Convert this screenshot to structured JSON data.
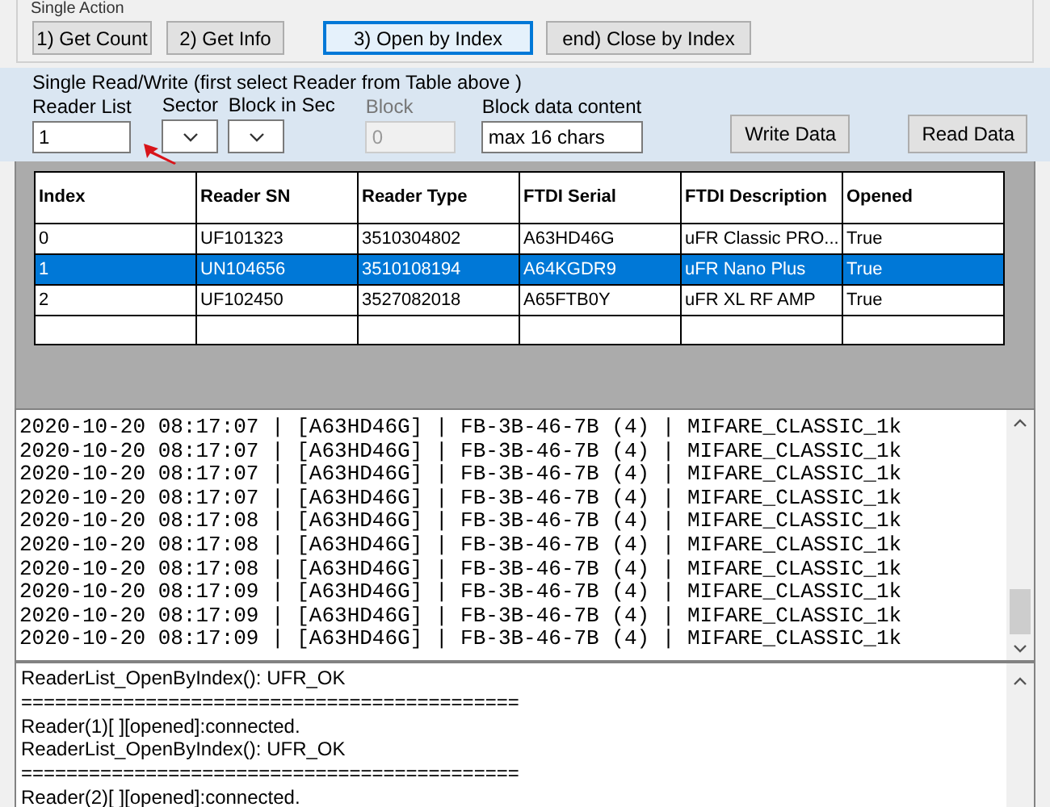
{
  "single_action": {
    "title": "Single Action",
    "buttons": [
      {
        "label": "1) Get Count",
        "selected": false
      },
      {
        "label": "2) Get Info",
        "selected": false
      },
      {
        "label": "3) Open by Index",
        "selected": true
      },
      {
        "label": "end) Close by Index",
        "selected": false
      }
    ]
  },
  "read_write": {
    "title": "Single Read/Write  (first select Reader from Table above )",
    "reader_list": {
      "label": "Reader List",
      "value": "1"
    },
    "sector": {
      "label": "Sector"
    },
    "block_in_sec": {
      "label": "Block in Sec"
    },
    "block": {
      "label": "Block",
      "value": "0",
      "disabled": true
    },
    "block_data": {
      "label": "Block data content",
      "value": "max 16 chars"
    },
    "buttons": [
      "Write Data",
      "Read Data"
    ]
  },
  "table": {
    "columns": [
      "Index",
      "Reader SN",
      "Reader Type",
      "FTDI Serial",
      "FTDI Description",
      "Opened"
    ],
    "rows": [
      {
        "cells": [
          "0",
          "UF101323",
          "3510304802",
          "A63HD46G",
          "uFR Classic PRO...",
          "True"
        ],
        "selected": false
      },
      {
        "cells": [
          "1",
          "UN104656",
          "3510108194",
          "A64KGDR9",
          "uFR Nano Plus",
          "True"
        ],
        "selected": true
      },
      {
        "cells": [
          "2",
          "UF102450",
          "3527082018",
          "A65FTB0Y",
          "uFR XL RF AMP",
          "True"
        ],
        "selected": false
      }
    ]
  },
  "card_log": [
    "2020-10-20 08:17:07 | [A63HD46G] | FB-3B-46-7B (4) | MIFARE_CLASSIC_1k",
    "2020-10-20 08:17:07 | [A63HD46G] | FB-3B-46-7B (4) | MIFARE_CLASSIC_1k",
    "2020-10-20 08:17:07 | [A63HD46G] | FB-3B-46-7B (4) | MIFARE_CLASSIC_1k",
    "2020-10-20 08:17:07 | [A63HD46G] | FB-3B-46-7B (4) | MIFARE_CLASSIC_1k",
    "2020-10-20 08:17:08 | [A63HD46G] | FB-3B-46-7B (4) | MIFARE_CLASSIC_1k",
    "2020-10-20 08:17:08 | [A63HD46G] | FB-3B-46-7B (4) | MIFARE_CLASSIC_1k",
    "2020-10-20 08:17:08 | [A63HD46G] | FB-3B-46-7B (4) | MIFARE_CLASSIC_1k",
    "2020-10-20 08:17:09 | [A63HD46G] | FB-3B-46-7B (4) | MIFARE_CLASSIC_1k",
    "2020-10-20 08:17:09 | [A63HD46G] | FB-3B-46-7B (4) | MIFARE_CLASSIC_1k",
    "2020-10-20 08:17:09 | [A63HD46G] | FB-3B-46-7B (4) | MIFARE_CLASSIC_1k"
  ],
  "status_log": [
    "ReaderList_OpenByIndex(): UFR_OK",
    "============================================",
    "Reader(1)[ ][opened]:connected.",
    "ReaderList_OpenByIndex(): UFR_OK",
    "============================================",
    "Reader(2)[ ][opened]:connected."
  ]
}
